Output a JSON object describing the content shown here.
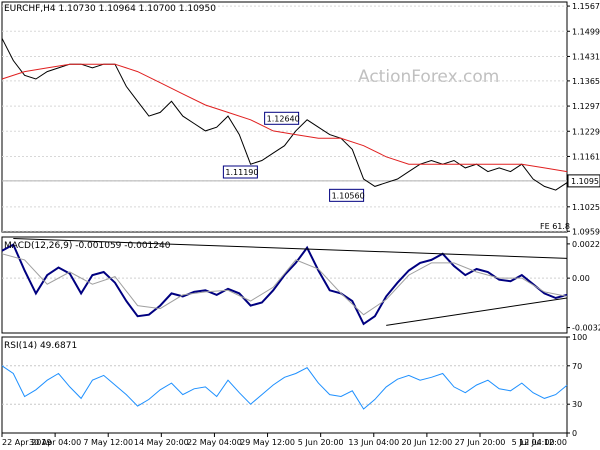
{
  "chart_data": [
    {
      "panel": "price",
      "type": "line",
      "header": "EURCHF,H4  1.10730 1.10964 1.10700 1.10950",
      "watermark": "ActionForex.com",
      "ylim": [
        1.0957,
        1.1578
      ],
      "yticks": [
        "1.15670",
        "1.14990",
        "1.14310",
        "1.13650",
        "1.12970",
        "1.12290",
        "1.11610",
        "1.10950",
        "1.10250",
        "1.09590"
      ],
      "current_price": "1.10950",
      "level_label": "FE 61.8",
      "annotations": [
        {
          "label": "1.12640",
          "x": 0.525,
          "y": 1.1264
        },
        {
          "label": "1.11190",
          "x": 0.452,
          "y": 1.1119
        },
        {
          "label": "1.10560",
          "x": 0.64,
          "y": 1.1056
        }
      ],
      "series": [
        {
          "name": "",
          "color": "#000000",
          "x": [
            0,
            0.02,
            0.04,
            0.06,
            0.08,
            0.1,
            0.12,
            0.14,
            0.16,
            0.18,
            0.2,
            0.22,
            0.24,
            0.26,
            0.28,
            0.3,
            0.32,
            0.34,
            0.36,
            0.38,
            0.4,
            0.42,
            0.44,
            0.46,
            0.48,
            0.5,
            0.52,
            0.54,
            0.56,
            0.58,
            0.6,
            0.62,
            0.64,
            0.66,
            0.68,
            0.7,
            0.72,
            0.74,
            0.76,
            0.78,
            0.8,
            0.82,
            0.84,
            0.86,
            0.88,
            0.9,
            0.92,
            0.94,
            0.96,
            0.98,
            1.0
          ],
          "values": [
            1.148,
            1.142,
            1.138,
            1.137,
            1.139,
            1.14,
            1.141,
            1.141,
            1.14,
            1.141,
            1.141,
            1.135,
            1.131,
            1.127,
            1.128,
            1.131,
            1.127,
            1.125,
            1.123,
            1.124,
            1.127,
            1.122,
            1.114,
            1.115,
            1.117,
            1.119,
            1.123,
            1.126,
            1.124,
            1.122,
            1.121,
            1.118,
            1.11,
            1.108,
            1.109,
            1.11,
            1.112,
            1.114,
            1.115,
            1.114,
            1.115,
            1.113,
            1.114,
            1.112,
            1.113,
            1.112,
            1.114,
            1.11,
            1.108,
            1.107,
            1.109
          ]
        },
        {
          "name": "",
          "color": "#e02020",
          "x": [
            0,
            0.04,
            0.08,
            0.12,
            0.16,
            0.2,
            0.24,
            0.28,
            0.32,
            0.36,
            0.4,
            0.44,
            0.48,
            0.52,
            0.56,
            0.6,
            0.64,
            0.68,
            0.72,
            0.76,
            0.8,
            0.84,
            0.88,
            0.92,
            0.96,
            1.0
          ],
          "values": [
            1.137,
            1.139,
            1.14,
            1.141,
            1.141,
            1.141,
            1.139,
            1.136,
            1.133,
            1.13,
            1.128,
            1.126,
            1.123,
            1.122,
            1.121,
            1.121,
            1.119,
            1.116,
            1.114,
            1.114,
            1.114,
            1.114,
            1.114,
            1.114,
            1.113,
            1.112
          ]
        }
      ]
    },
    {
      "panel": "macd",
      "type": "line",
      "header": "MACD(12,26,9) -0.001059 -0.001240",
      "ylim": [
        -0.0036,
        0.0027
      ],
      "yticks": [
        "0.002248",
        "0.00",
        "-0.003245"
      ],
      "series": [
        {
          "name": "",
          "color": "#000080",
          "x": [
            0,
            0.02,
            0.04,
            0.06,
            0.08,
            0.1,
            0.12,
            0.14,
            0.16,
            0.18,
            0.2,
            0.22,
            0.24,
            0.26,
            0.28,
            0.3,
            0.32,
            0.34,
            0.36,
            0.38,
            0.4,
            0.42,
            0.44,
            0.46,
            0.48,
            0.5,
            0.52,
            0.54,
            0.56,
            0.58,
            0.6,
            0.62,
            0.64,
            0.66,
            0.68,
            0.7,
            0.72,
            0.74,
            0.76,
            0.78,
            0.8,
            0.82,
            0.84,
            0.86,
            0.88,
            0.9,
            0.92,
            0.94,
            0.96,
            0.98,
            1.0
          ],
          "values": [
            0.0018,
            0.0022,
            0.0005,
            -0.001,
            0.0002,
            0.0007,
            0.0003,
            -0.001,
            0.0002,
            0.0004,
            -0.0003,
            -0.0015,
            -0.0025,
            -0.0024,
            -0.0018,
            -0.001,
            -0.0012,
            -0.0009,
            -0.0008,
            -0.0011,
            -0.0007,
            -0.001,
            -0.0018,
            -0.0016,
            -0.0008,
            0.0002,
            0.001,
            0.002,
            0.0005,
            -0.0008,
            -0.001,
            -0.0015,
            -0.003,
            -0.0025,
            -0.0012,
            -0.0003,
            0.0005,
            0.001,
            0.0012,
            0.0016,
            0.0008,
            0.0002,
            0.0006,
            0.0004,
            -0.0001,
            -0.0002,
            0.0002,
            -0.0004,
            -0.001,
            -0.0013,
            -0.0011
          ]
        },
        {
          "name": "",
          "color": "#a0a0a0",
          "x": [
            0,
            0.04,
            0.08,
            0.12,
            0.16,
            0.2,
            0.24,
            0.28,
            0.32,
            0.36,
            0.4,
            0.44,
            0.48,
            0.52,
            0.56,
            0.6,
            0.64,
            0.68,
            0.72,
            0.76,
            0.8,
            0.84,
            0.88,
            0.92,
            0.96,
            1.0
          ],
          "values": [
            0.0016,
            0.0012,
            -0.0004,
            0.0004,
            -0.0004,
            0.0001,
            -0.0018,
            -0.002,
            -0.0011,
            -0.0009,
            -0.0008,
            -0.0015,
            -0.0006,
            0.0012,
            0.0006,
            -0.001,
            -0.0024,
            -0.0014,
            0.0002,
            0.001,
            0.001,
            0.0004,
            0.0,
            0.0,
            -0.0009,
            -0.0012
          ]
        }
      ]
    },
    {
      "panel": "rsi",
      "type": "line",
      "header": "RSI(14) 49.6871",
      "ylim": [
        0,
        100
      ],
      "yticks": [
        "100",
        "70",
        "30",
        "0"
      ],
      "series": [
        {
          "name": "",
          "color": "#1e90ff",
          "x": [
            0,
            0.02,
            0.04,
            0.06,
            0.08,
            0.1,
            0.12,
            0.14,
            0.16,
            0.18,
            0.2,
            0.22,
            0.24,
            0.26,
            0.28,
            0.3,
            0.32,
            0.34,
            0.36,
            0.38,
            0.4,
            0.42,
            0.44,
            0.46,
            0.48,
            0.5,
            0.52,
            0.54,
            0.56,
            0.58,
            0.6,
            0.62,
            0.64,
            0.66,
            0.68,
            0.7,
            0.72,
            0.74,
            0.76,
            0.78,
            0.8,
            0.82,
            0.84,
            0.86,
            0.88,
            0.9,
            0.92,
            0.94,
            0.96,
            0.98,
            1.0
          ],
          "values": [
            70,
            62,
            38,
            45,
            55,
            62,
            48,
            36,
            55,
            60,
            50,
            40,
            28,
            35,
            45,
            52,
            40,
            46,
            48,
            38,
            55,
            42,
            30,
            40,
            50,
            58,
            62,
            68,
            52,
            40,
            38,
            44,
            25,
            35,
            48,
            56,
            60,
            55,
            58,
            62,
            48,
            42,
            50,
            55,
            46,
            44,
            52,
            42,
            36,
            40,
            49.7
          ]
        }
      ]
    }
  ],
  "x_axis": {
    "labels": [
      "22 Apr 2019",
      "30 Apr 04:00",
      "7 May 12:00",
      "14 May 20:00",
      "22 May 04:00",
      "29 May 12:00",
      "5 Jun 20:00",
      "13 Jun 04:00",
      "20 Jun 12:00",
      "27 Jun 20:00",
      "5 Jul 04:00",
      "12 Jul 12:00"
    ],
    "positions": [
      0.0,
      0.094,
      0.188,
      0.282,
      0.376,
      0.47,
      0.564,
      0.658,
      0.752,
      0.846,
      0.94,
      1.034
    ]
  },
  "colors": {
    "price": "#000000",
    "ma": "#e02020",
    "macd": "#000080",
    "signal": "#a0a0a0",
    "rsi": "#1e90ff",
    "trendline": "#000000"
  }
}
